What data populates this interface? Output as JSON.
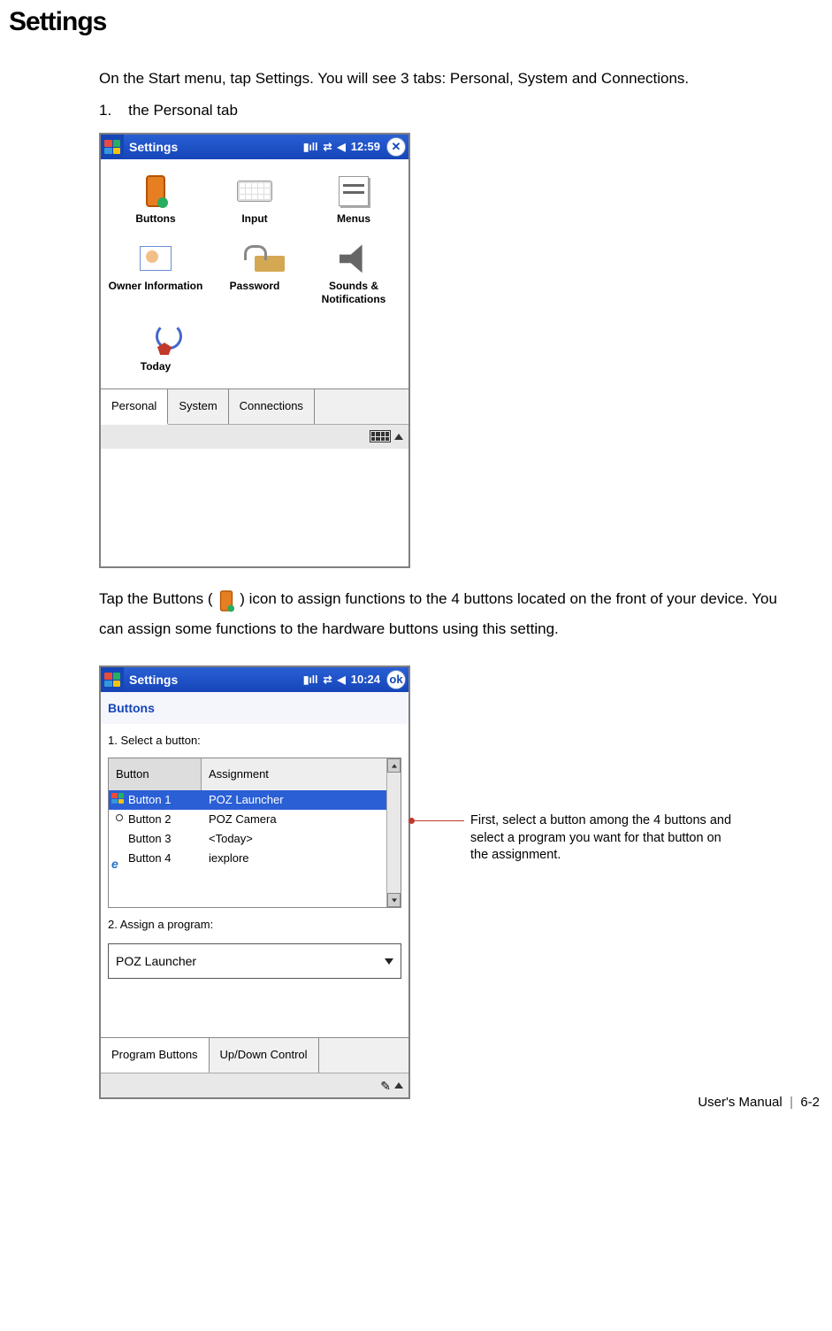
{
  "page": {
    "title": "Settings",
    "intro": "On the Start menu, tap Settings.    You will see 3 tabs: Personal, System and Connections.",
    "item1_num": "1.",
    "item1_text": "the Personal tab",
    "mid_before": "Tap the Buttons (",
    "mid_after": " ) icon to assign functions to the 4 buttons located on the front of your device. You can assign some functions to the hardware buttons using this setting.",
    "footer_label": "User's Manual",
    "footer_sep": "|",
    "footer_page": "6-2"
  },
  "screenshot1": {
    "title": "Settings",
    "time": "12:59",
    "close_glyph": "✕",
    "icons": {
      "buttons": "Buttons",
      "input": "Input",
      "menus": "Menus",
      "owner": "Owner Information",
      "password": "Password",
      "sounds": "Sounds & Notifications",
      "today": "Today"
    },
    "tabs": {
      "personal": "Personal",
      "system": "System",
      "connections": "Connections"
    }
  },
  "screenshot2": {
    "title": "Settings",
    "time": "10:24",
    "ok_label": "ok",
    "subheader": "Buttons",
    "label1": "1. Select a button:",
    "headers": {
      "button": "Button",
      "assignment": "Assignment"
    },
    "rows": [
      {
        "btn": "Button 1",
        "assign": "POZ Launcher"
      },
      {
        "btn": "Button 2",
        "assign": "POZ Camera"
      },
      {
        "btn": "Button 3",
        "assign": "<Today>"
      },
      {
        "btn": "Button 4",
        "assign": "iexplore"
      }
    ],
    "label2": "2. Assign a program:",
    "dropdown_value": "POZ Launcher",
    "tabs": {
      "program": "Program Buttons",
      "updown": "Up/Down Control"
    }
  },
  "annotation": {
    "text": "First, select a button among the 4 buttons and select a program you want for that button on the assignment."
  }
}
